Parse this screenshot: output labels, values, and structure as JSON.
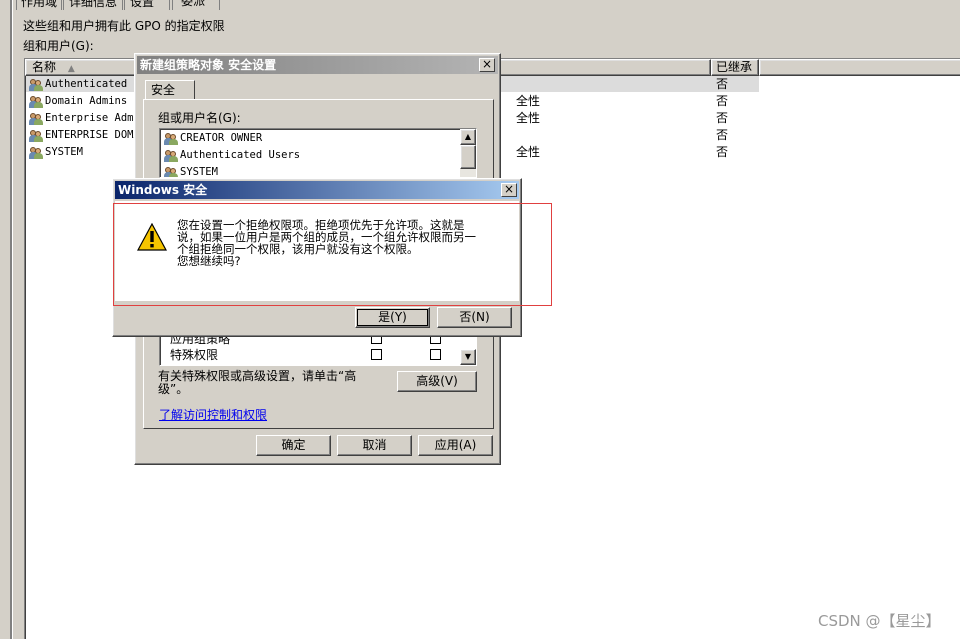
{
  "background": {
    "tabs": [
      "作用域",
      "详细信息",
      "设置",
      "委派"
    ],
    "description": "这些组和用户拥有此 GPO 的指定权限",
    "group_label": "组和用户(G):",
    "columns": [
      "名称",
      "已继承"
    ],
    "rows": [
      {
        "name": "Authenticated U",
        "perm": "",
        "inherited": "否"
      },
      {
        "name": "Domain Admins",
        "perm": "全性",
        "inherited": "否"
      },
      {
        "name": "Enterprise Admi",
        "perm": "全性",
        "inherited": "否"
      },
      {
        "name": "ENTERPRISE DOMA",
        "perm": "",
        "inherited": "否"
      },
      {
        "name": "SYSTEM",
        "perm": "全性",
        "inherited": "否"
      }
    ]
  },
  "security_dialog": {
    "title": "新建组策略对象 安全设置",
    "close": "×",
    "tab": "安全",
    "group_label": "组或用户名(G):",
    "users": [
      "CREATOR OWNER",
      "Authenticated Users",
      "SYSTEM"
    ],
    "perm_rows": [
      "应用组策略",
      "特殊权限"
    ],
    "special_note": "有关特殊权限或高级设置，请单击“高级”。",
    "advanced_button": "高级(V)",
    "learn_link": "了解访问控制和权限",
    "ok_button": "确定",
    "cancel_button": "取消",
    "apply_button": "应用(A)"
  },
  "alert_dialog": {
    "title": "Windows 安全",
    "close": "×",
    "message_lines": [
      "您在设置一个拒绝权限项。拒绝项优先于允许项。这就是",
      "说，如果一位用户是两个组的成员，一个组允许权限而另一",
      "个组拒绝同一个权限，该用户就没有这个权限。",
      "您想继续吗?"
    ],
    "yes_button": "是(Y)",
    "no_button": "否(N)"
  },
  "watermark": "CSDN @【星尘】",
  "colors": {
    "title_active": "#0a246a",
    "title_inactive": "#808080",
    "highlight_box": "#e04040",
    "link": "#0000ee"
  }
}
